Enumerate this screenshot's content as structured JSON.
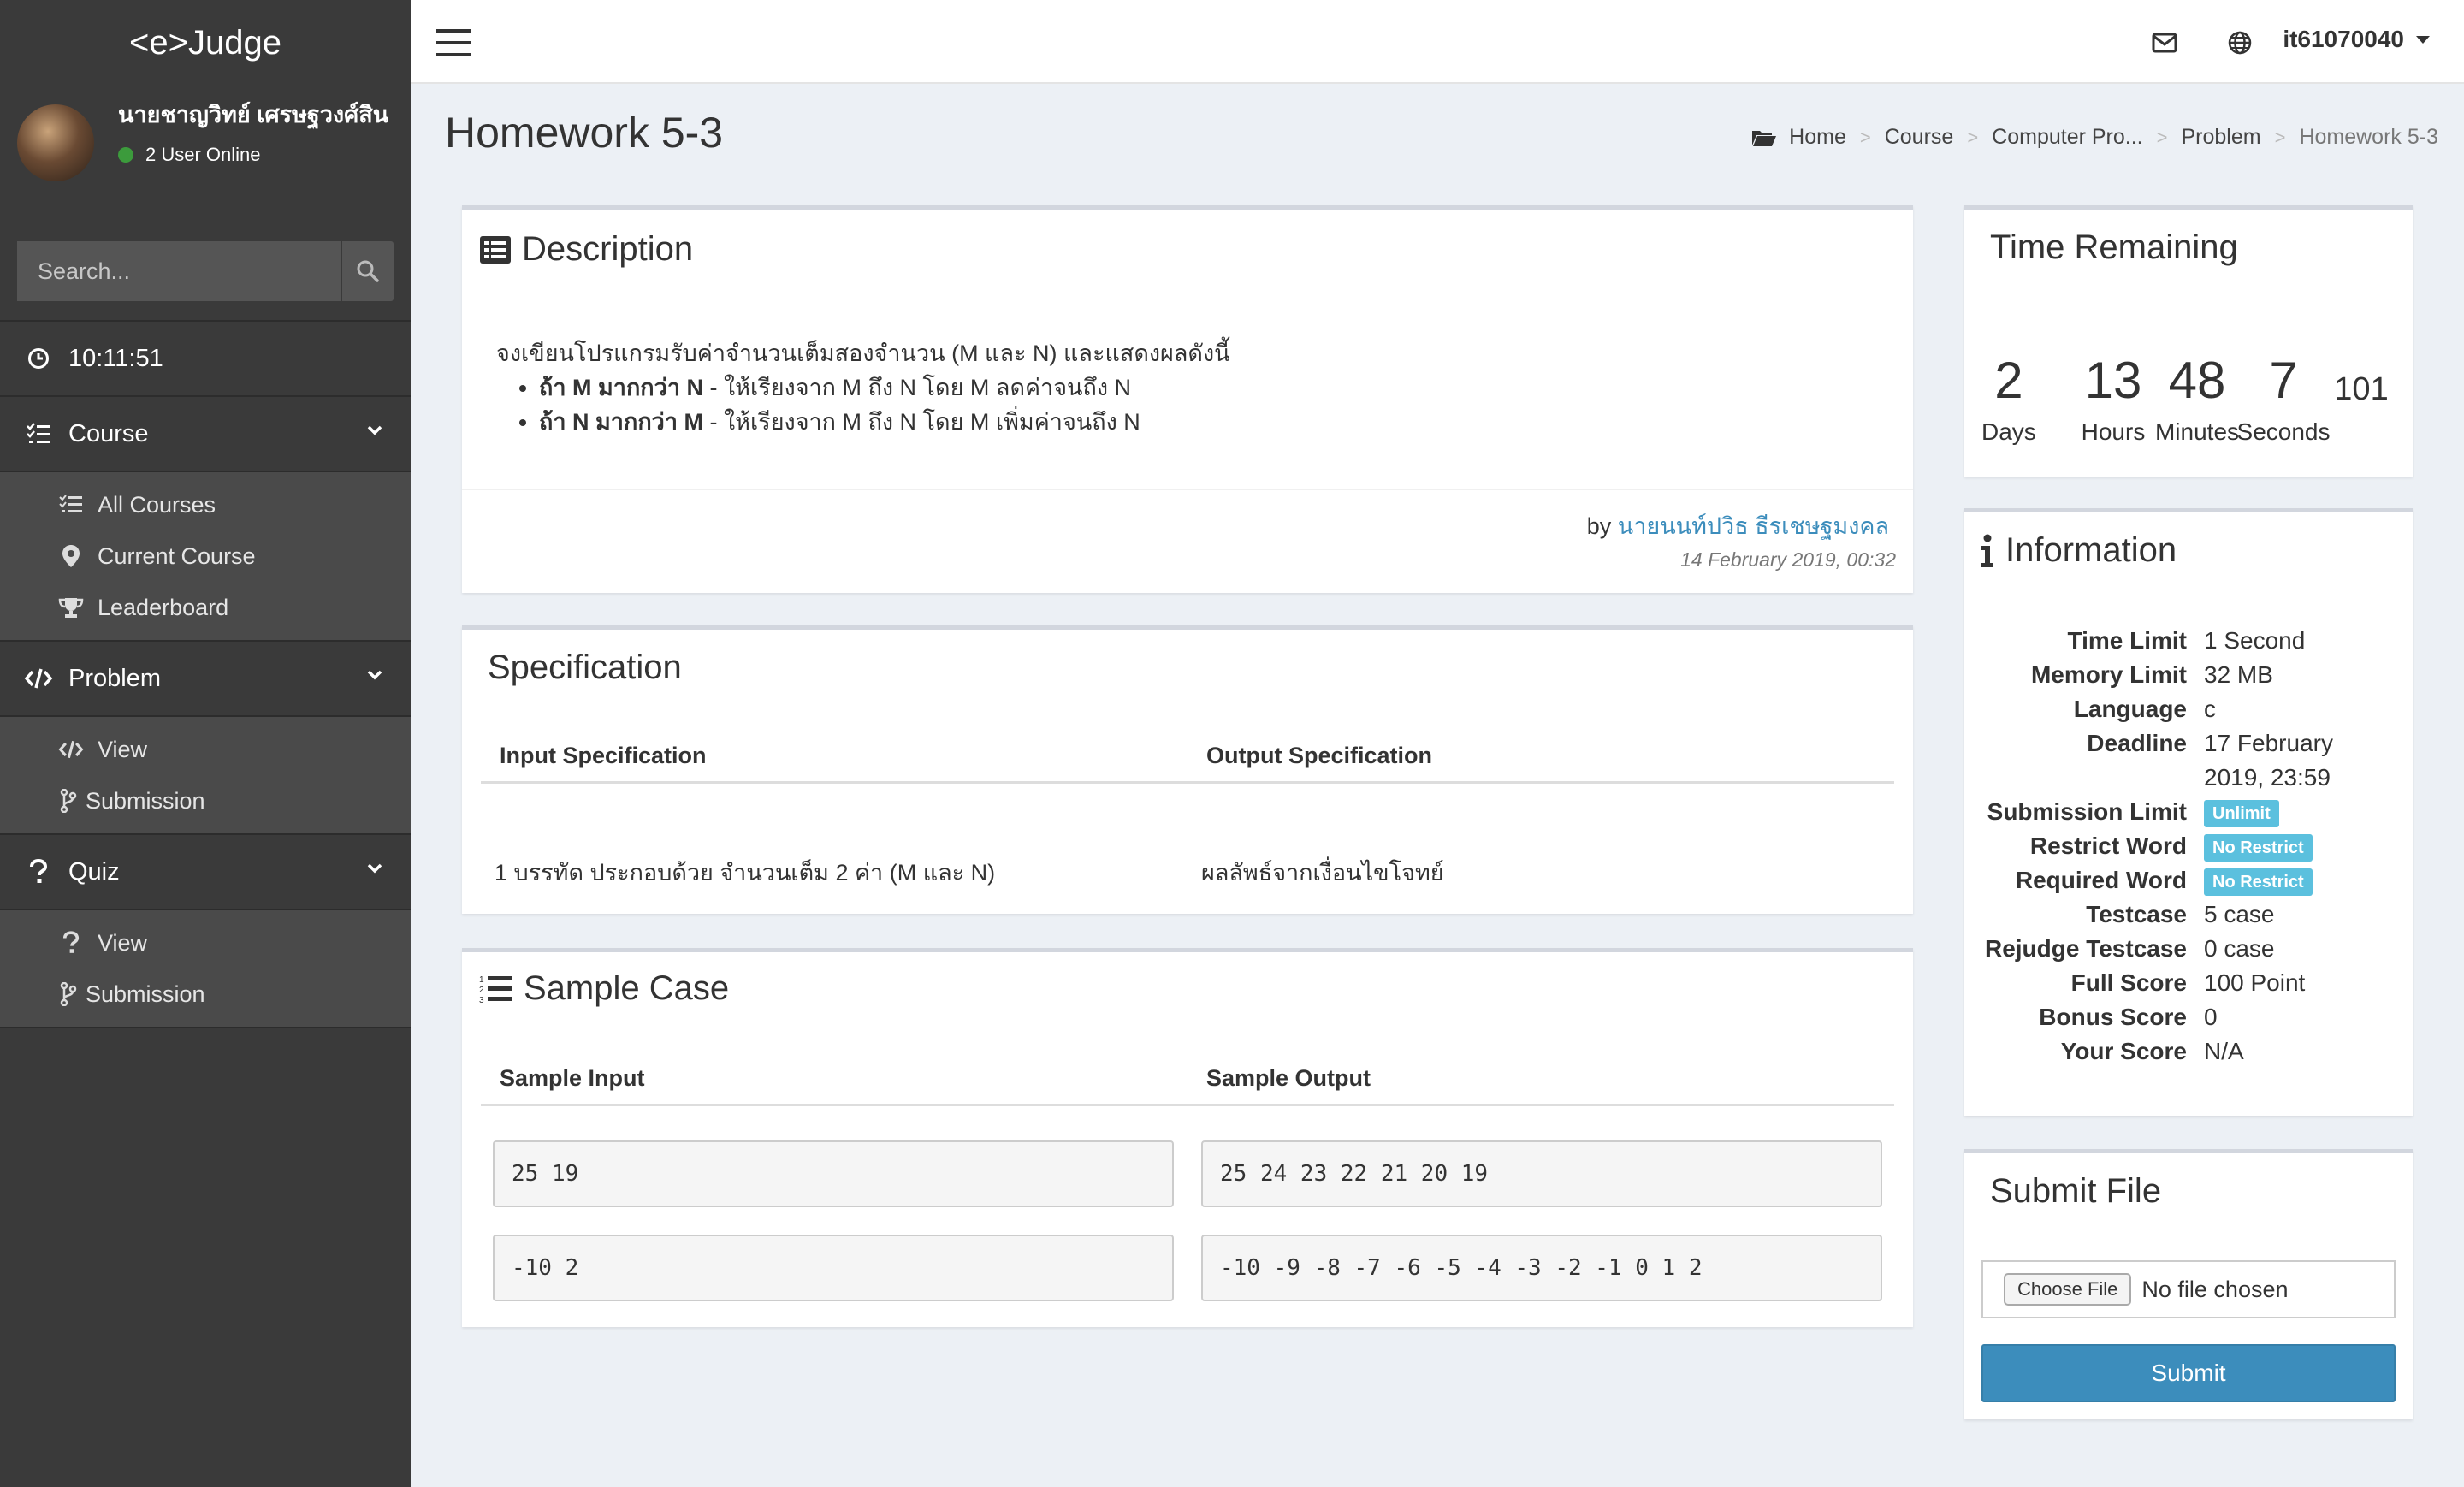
{
  "app": {
    "logo": "<e>Judge"
  },
  "user": {
    "name": "นายชาญวิทย์ เศรษฐวงศ์สิน",
    "status": "2 User Online"
  },
  "search": {
    "placeholder": "Search..."
  },
  "sidebar": {
    "clock": "10:11:51",
    "course": {
      "label": "Course",
      "items": [
        "All Courses",
        "Current Course",
        "Leaderboard"
      ]
    },
    "problem": {
      "label": "Problem",
      "items": [
        "View",
        "Submission"
      ]
    },
    "quiz": {
      "label": "Quiz",
      "items": [
        "View",
        "Submission"
      ]
    }
  },
  "topbar": {
    "username": "it61070040"
  },
  "page": {
    "title": "Homework 5-3"
  },
  "breadcrumb": [
    "Home",
    "Course",
    "Computer Pro...",
    "Problem",
    "Homework 5-3"
  ],
  "description": {
    "title": "Description",
    "intro": "จงเขียนโปรแกรมรับค่าจำนวนเต็มสองจำนวน (M และ N) และแสดงผลดังนี้",
    "bullets": [
      {
        "bold": "ถ้า M มากกว่า N",
        "text": " - ให้เรียงจาก M ถึง N โดย M ลดค่าจนถึง N"
      },
      {
        "bold": "ถ้า N มากกว่า M",
        "text": " - ให้เรียงจาก M ถึง N โดย M เพิ่มค่าจนถึง N"
      }
    ],
    "by_prefix": "by",
    "author": "นายนนท์ปวิธ ธีรเชษฐมงคล",
    "date": "14 February 2019, 00:32"
  },
  "specification": {
    "title": "Specification",
    "input_header": "Input Specification",
    "output_header": "Output Specification",
    "input": "1 บรรทัด ประกอบด้วย จำนวนเต็ม 2 ค่า (M และ N)",
    "output": "ผลลัพธ์จากเงื่อนไขโจทย์"
  },
  "sample": {
    "title": "Sample Case",
    "input_header": "Sample Input",
    "output_header": "Sample Output",
    "cases": [
      {
        "input": "25 19",
        "output": "25 24 23 22 21 20 19"
      },
      {
        "input": "-10 2",
        "output": "-10 -9 -8 -7 -6 -5 -4 -3 -2 -1 0 1 2"
      }
    ]
  },
  "time_remaining": {
    "title": "Time Remaining",
    "days": "2",
    "hours": "13",
    "minutes": "48",
    "seconds": "7",
    "ms": "101",
    "labels": [
      "Days",
      "Hours",
      "Minutes",
      "Seconds"
    ]
  },
  "information": {
    "title": "Information",
    "rows": [
      {
        "key": "Time Limit",
        "value": "1 Second"
      },
      {
        "key": "Memory Limit",
        "value": "32 MB"
      },
      {
        "key": "Language",
        "value": "c"
      },
      {
        "key": "Deadline",
        "value": "17 February 2019, 23:59"
      },
      {
        "key": "Submission Limit",
        "badge": "Unlimit"
      },
      {
        "key": "Restrict Word",
        "badge": "No Restrict"
      },
      {
        "key": "Required Word",
        "badge": "No Restrict"
      },
      {
        "key": "Testcase",
        "value": "5 case"
      },
      {
        "key": "Rejudge Testcase",
        "value": "0 case"
      },
      {
        "key": "Full Score",
        "value": "100 Point"
      },
      {
        "key": "Bonus Score",
        "value": "0"
      },
      {
        "key": "Your Score",
        "value": "N/A"
      }
    ]
  },
  "submit": {
    "title": "Submit File",
    "choose_label": "Choose File",
    "no_file": "No file chosen",
    "button": "Submit"
  },
  "colors": {
    "primary": "#3c8dbc",
    "badge": "#5bc0de",
    "sidebar": "#3a3a3a",
    "online": "#3c9b3c"
  },
  "icons": [
    "clock-icon",
    "course-list-icon",
    "code-icon",
    "question-icon",
    "list-icon",
    "map-marker-icon",
    "trophy-icon",
    "branch-icon",
    "envelope-icon",
    "globe-icon",
    "folder-icon",
    "info-icon",
    "search-icon"
  ]
}
